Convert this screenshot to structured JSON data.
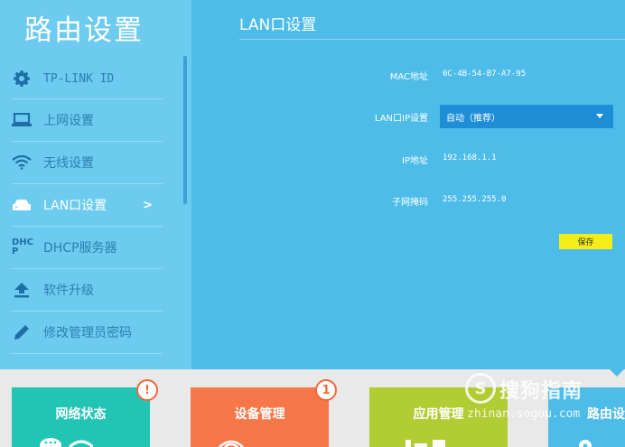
{
  "app": {
    "title": "路由设置"
  },
  "sidebar": {
    "items": [
      {
        "label": "TP-LINK ID",
        "icon": "gear-icon"
      },
      {
        "label": "上网设置",
        "icon": "laptop-icon"
      },
      {
        "label": "无线设置",
        "icon": "wifi-icon"
      },
      {
        "label": "LAN口设置",
        "icon": "router-icon",
        "active": true,
        "arrow": ">"
      },
      {
        "label": "DHCP服务器",
        "icon": "dhcp-icon"
      },
      {
        "label": "软件升级",
        "icon": "upload-icon"
      },
      {
        "label": "修改管理员密码",
        "icon": "pencil-icon"
      }
    ]
  },
  "dhcp_icon_text": {
    "line1": "DHC",
    "line2": "P"
  },
  "panel": {
    "title": "LAN口设置",
    "mac_label": "MAC地址",
    "mac_value": "0C-4B-54-B7-A7-95",
    "lanip_label": "LAN口IP设置",
    "lanip_mode": "自动（推荐）",
    "ip_label": "IP地址",
    "ip_value": "192.168.1.1",
    "mask_label": "子网掩码",
    "mask_value": "255.255.255.0",
    "save_label": "保存"
  },
  "bottom": {
    "tiles": [
      {
        "label": "网络状态",
        "color": "#22c5b3",
        "badge": "!"
      },
      {
        "label": "设备管理",
        "color": "#f6774a",
        "badge": "1"
      },
      {
        "label": "应用管理",
        "color": "#b2cc34"
      },
      {
        "label": "路由设",
        "color": "#4ebce9"
      }
    ]
  },
  "watermark": {
    "logo": "S",
    "name": "搜狗指南",
    "url": "zhinan.sogou.com"
  },
  "colors": {
    "sidebar": "#6ccbef",
    "main": "#4ebce9",
    "select": "#1e8fd6",
    "save": "#f5ed18"
  }
}
